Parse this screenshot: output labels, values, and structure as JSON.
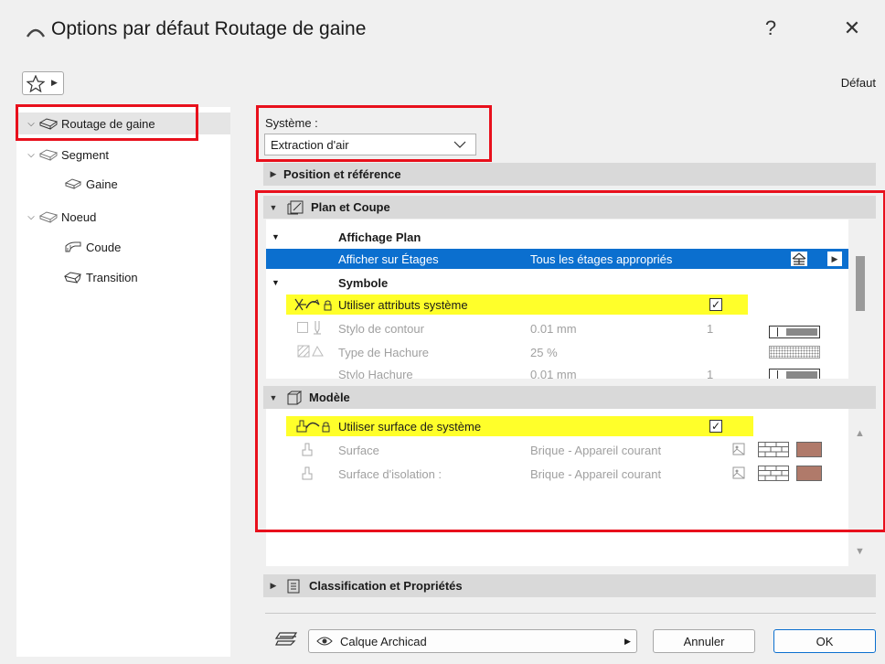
{
  "window": {
    "title": "Options par défaut Routage de gaine",
    "help": "?",
    "close": "✕"
  },
  "top": {
    "default_label": "Défaut"
  },
  "tree": {
    "items": [
      {
        "label": "Routage de gaine"
      },
      {
        "label": "Segment"
      },
      {
        "label": "Gaine"
      },
      {
        "label": "Noeud"
      },
      {
        "label": "Coude"
      },
      {
        "label": "Transition"
      }
    ]
  },
  "system": {
    "label": "Système :",
    "value": "Extraction d'air"
  },
  "panels": {
    "position": "Position et référence",
    "plan": "Plan et Coupe",
    "model": "Modèle",
    "classification": "Classification et Propriétés"
  },
  "plan_rows": {
    "affichage_header": "Affichage Plan",
    "afficher_name": "Afficher sur Étages",
    "afficher_value": "Tous les étages appropriés",
    "symbole_header": "Symbole",
    "use_sys_attr": "Utiliser attributs système",
    "stylo_name": "Stylo de contour",
    "stylo_value": "0.01 mm",
    "stylo_num": "1",
    "hachure_name": "Type de Hachure",
    "hachure_value": "25 %",
    "style_hachure_name": "Stylo Hachure",
    "style_hachure_value": "0.01 mm",
    "style_hachure_num": "1"
  },
  "model_rows": {
    "use_sys_surface": "Utiliser surface de système",
    "surface_name": "Surface",
    "surface_value": "Brique - Appareil courant",
    "insulation_name": "Surface d'isolation :",
    "insulation_value": "Brique - Appareil courant"
  },
  "footer": {
    "layer": "Calque Archicad",
    "cancel": "Annuler",
    "ok": "OK"
  },
  "colors": {
    "highlight": "#ffff2a",
    "selection": "#0b6fcf",
    "annotation_red": "#e8101c",
    "brick": "#b07a6a"
  }
}
